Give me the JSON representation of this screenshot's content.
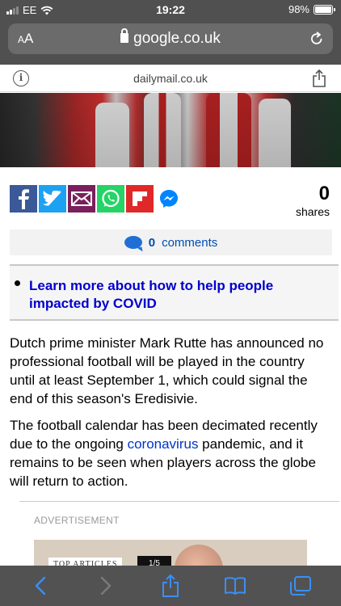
{
  "status_bar": {
    "carrier": "EE",
    "time": "19:22",
    "battery": "98%",
    "battery_level": 0.98
  },
  "browser": {
    "text_size_label_small": "A",
    "text_size_label_large": "A",
    "url": "google.co.uk",
    "amp_domain": "dailymail.co.uk"
  },
  "share": {
    "buttons": [
      {
        "name": "facebook",
        "color": "#3b5998"
      },
      {
        "name": "twitter",
        "color": "#1da1f2"
      },
      {
        "name": "email",
        "color": "#7a1f5c"
      },
      {
        "name": "whatsapp",
        "color": "#25d366"
      },
      {
        "name": "flipboard",
        "color": "#e12828"
      },
      {
        "name": "messenger",
        "color": "#0084ff"
      }
    ],
    "count": "0",
    "count_label": "shares"
  },
  "comments": {
    "count": "0",
    "label": "comments"
  },
  "covid_box": {
    "link_text": "Learn more about how to help people impacted by COVID"
  },
  "article": {
    "paragraph1": "Dutch prime minister Mark Rutte has announced no professional football will be played in the country until at least September 1, which could signal the end of this season's Eredisivie.",
    "paragraph2_before": "The football calendar has been decimated recently due to the ongoing ",
    "paragraph2_link": "coronavirus",
    "paragraph2_after": " pandemic, and it remains to be seen when players across the globe will return to action."
  },
  "advert": {
    "label": "ADVERTISEMENT",
    "tag": "TOP ARTICLES",
    "tag_count": "1/5"
  },
  "toolbar": {
    "icons": [
      "back-icon",
      "forward-icon",
      "share-icon",
      "bookmarks-icon",
      "tabs-icon"
    ]
  }
}
